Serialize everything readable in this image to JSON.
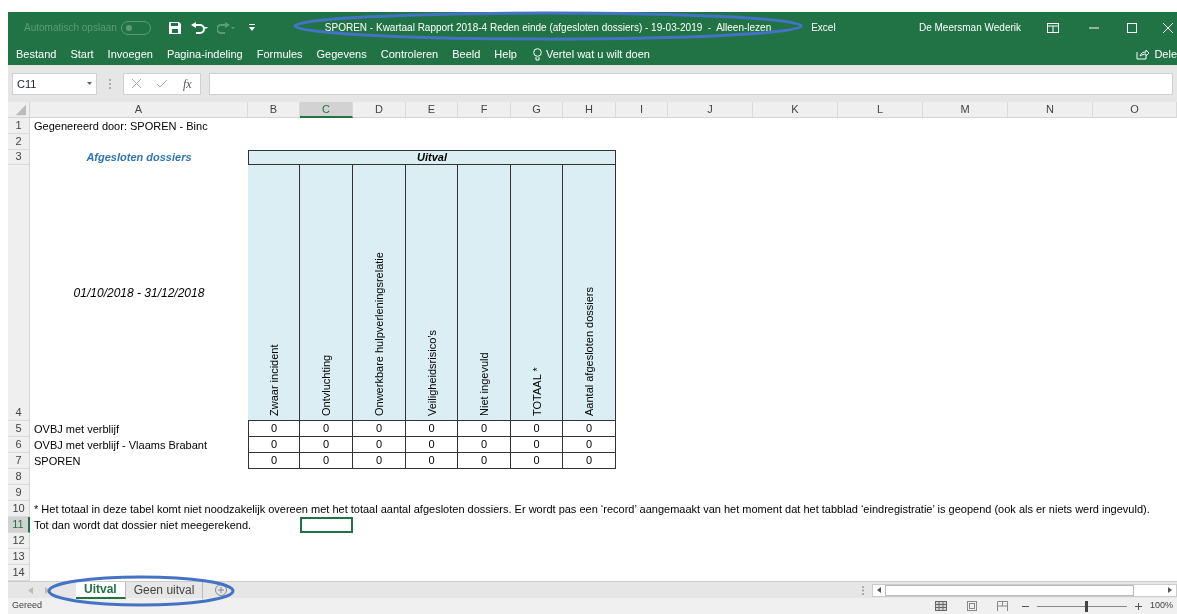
{
  "title_bar": {
    "autosave": {
      "label": "Automatisch opslaan",
      "on": false
    },
    "title": "SPOREN - Kwartaal Rapport 2018-4 Reden einde (afgesloten dossiers) - 19-03-2019  -  Alleen-lezen",
    "title_circled": true,
    "app": "Excel",
    "user": "De Meersman Wederik"
  },
  "ribbon": {
    "tabs": [
      "Bestand",
      "Start",
      "Invoegen",
      "Pagina-indeling",
      "Formules",
      "Gegevens",
      "Controleren",
      "Beeld",
      "Help"
    ],
    "tell_me": "Vertel wat u wilt doen",
    "share": "Dele"
  },
  "formula_bar": {
    "name_box": "C11",
    "function_label": "fx"
  },
  "sheet": {
    "columns": [
      {
        "label": "A",
        "selected": false
      },
      {
        "label": "B",
        "selected": false
      },
      {
        "label": "C",
        "selected": true
      },
      {
        "label": "D",
        "selected": false
      },
      {
        "label": "E",
        "selected": false
      },
      {
        "label": "F",
        "selected": false
      },
      {
        "label": "G",
        "selected": false
      },
      {
        "label": "H",
        "selected": false
      },
      {
        "label": "I",
        "selected": false
      },
      {
        "label": "J",
        "selected": false
      },
      {
        "label": "K",
        "selected": false
      },
      {
        "label": "L",
        "selected": false
      },
      {
        "label": "M",
        "selected": false
      },
      {
        "label": "N",
        "selected": false
      },
      {
        "label": "O",
        "selected": false
      }
    ],
    "rows": [
      {
        "label": "1",
        "selected": false
      },
      {
        "label": "2",
        "selected": false
      },
      {
        "label": "3",
        "selected": false
      },
      {
        "label": "4",
        "selected": false
      },
      {
        "label": "5",
        "selected": false
      },
      {
        "label": "6",
        "selected": false
      },
      {
        "label": "7",
        "selected": false
      },
      {
        "label": "8",
        "selected": false
      },
      {
        "label": "9",
        "selected": false
      },
      {
        "label": "10",
        "selected": false
      },
      {
        "label": "11",
        "selected": true
      },
      {
        "label": "12",
        "selected": false
      },
      {
        "label": "13",
        "selected": false
      },
      {
        "label": "14",
        "selected": false
      }
    ],
    "generated_by": "Gegenereerd door: SPOREN - Binc",
    "section_title": "Afgesloten dossiers",
    "period": "01/10/2018 - 31/12/2018",
    "group_header": "Uitval",
    "measures": [
      "Zwaar incident",
      "Ontvluchting",
      "Onwerkbare hulpverleningsrelatie",
      "Veiligheidsrisico’s",
      "Niet ingevuld",
      "TOTAAL *",
      "Aantal afgesloten dossiers"
    ],
    "data_rows": [
      {
        "label": "OVBJ met verblijf",
        "values": [
          "0",
          "0",
          "0",
          "0",
          "0",
          "0",
          "0"
        ]
      },
      {
        "label": "OVBJ met verblijf - Vlaams Brabant",
        "values": [
          "0",
          "0",
          "0",
          "0",
          "0",
          "0",
          "0"
        ]
      },
      {
        "label": "SPOREN",
        "values": [
          "0",
          "0",
          "0",
          "0",
          "0",
          "0",
          "0"
        ]
      }
    ],
    "notes": [
      "* Het totaal in deze tabel komt niet noodzakelijk overeen met het totaal aantal afgesloten dossiers. Er wordt pas een ‘record’  aangemaakt van het moment dat het tabblad ‘eindregistratie’ is geopend (ook als er niets werd ingevuld).",
      "Tot dan wordt dat dossier niet meegerekend."
    ]
  },
  "sheet_tabs": {
    "circled": true,
    "tabs": [
      {
        "label": "Uitval",
        "selected": true
      },
      {
        "label": "Geen uitval",
        "selected": false
      }
    ]
  },
  "status_bar": {
    "status": "Gereed",
    "zoom": {
      "level": 0.55,
      "label": "100%"
    }
  }
}
